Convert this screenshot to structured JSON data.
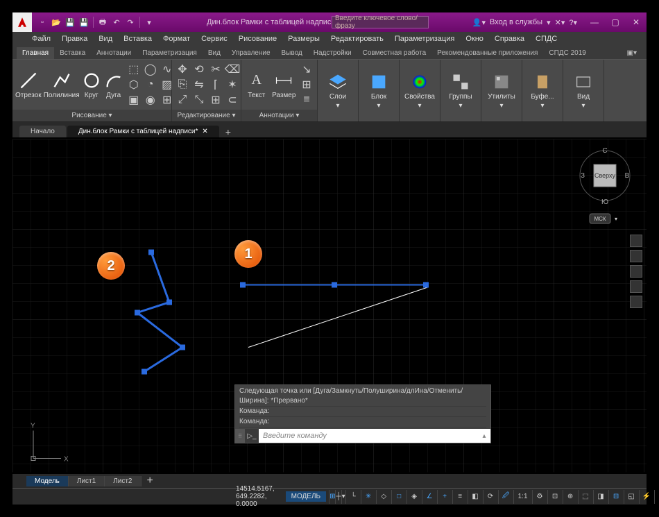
{
  "titlebar": {
    "title": "Дин.блок Рамки с таблицей надписи...",
    "search_placeholder": "Введите ключевое слово/фразу",
    "signin": "Вход в службы"
  },
  "menubar": [
    "Файл",
    "Правка",
    "Вид",
    "Вставка",
    "Формат",
    "Сервис",
    "Рисование",
    "Размеры",
    "Редактировать",
    "Параметризация",
    "Окно",
    "Справка",
    "СПДС"
  ],
  "ribbon_tabs": [
    "Главная",
    "Вставка",
    "Аннотации",
    "Параметризация",
    "Вид",
    "Управление",
    "Вывод",
    "Надстройки",
    "Совместная работа",
    "Рекомендованные приложения",
    "СПДС 2019"
  ],
  "ribbon_tabs_active": 0,
  "panels": {
    "draw": {
      "title": "Рисование ▾",
      "big": [
        {
          "label": "Отрезок"
        },
        {
          "label": "Полилиния"
        },
        {
          "label": "Круг"
        },
        {
          "label": "Дуга"
        }
      ]
    },
    "modify": {
      "title": "Редактирование ▾"
    },
    "annot": {
      "title": "Аннотации ▾",
      "big": [
        {
          "label": "Текст"
        },
        {
          "label": "Размер"
        }
      ]
    },
    "layers": {
      "title": "Слои",
      "big": "Слои"
    },
    "block": {
      "title": "Блок",
      "big": "Блок"
    },
    "props": {
      "title": "Свойства",
      "big": "Свойства"
    },
    "groups": {
      "title": "Группы",
      "big": "Группы"
    },
    "utils": {
      "title": "Утилиты",
      "big": "Утилиты"
    },
    "clip": {
      "title": "Буфе...",
      "big": "Буфе..."
    },
    "view": {
      "title": "Вид",
      "big": "Вид"
    }
  },
  "doc_tabs": {
    "start": "Начало",
    "active": "Дин.блок Рамки с таблицей надписи*"
  },
  "viewcube": {
    "n": "С",
    "s": "Ю",
    "e": "В",
    "w": "З",
    "face": "Сверху",
    "wcs": "МСК"
  },
  "callouts": {
    "one": "1",
    "two": "2"
  },
  "command": {
    "history": [
      "Следующая точка или [Дуга/Замкнуть/Полуширина/длИна/Отменить/Ширина]: *Прервано*",
      "Команда:",
      "Команда:"
    ],
    "placeholder": "Введите команду"
  },
  "layout_tabs": [
    "Модель",
    "Лист1",
    "Лист2"
  ],
  "status": {
    "coords": "14514.5167, 649.2282, 0.0000",
    "space": "МОДЕЛЬ",
    "scale": "1:1"
  }
}
